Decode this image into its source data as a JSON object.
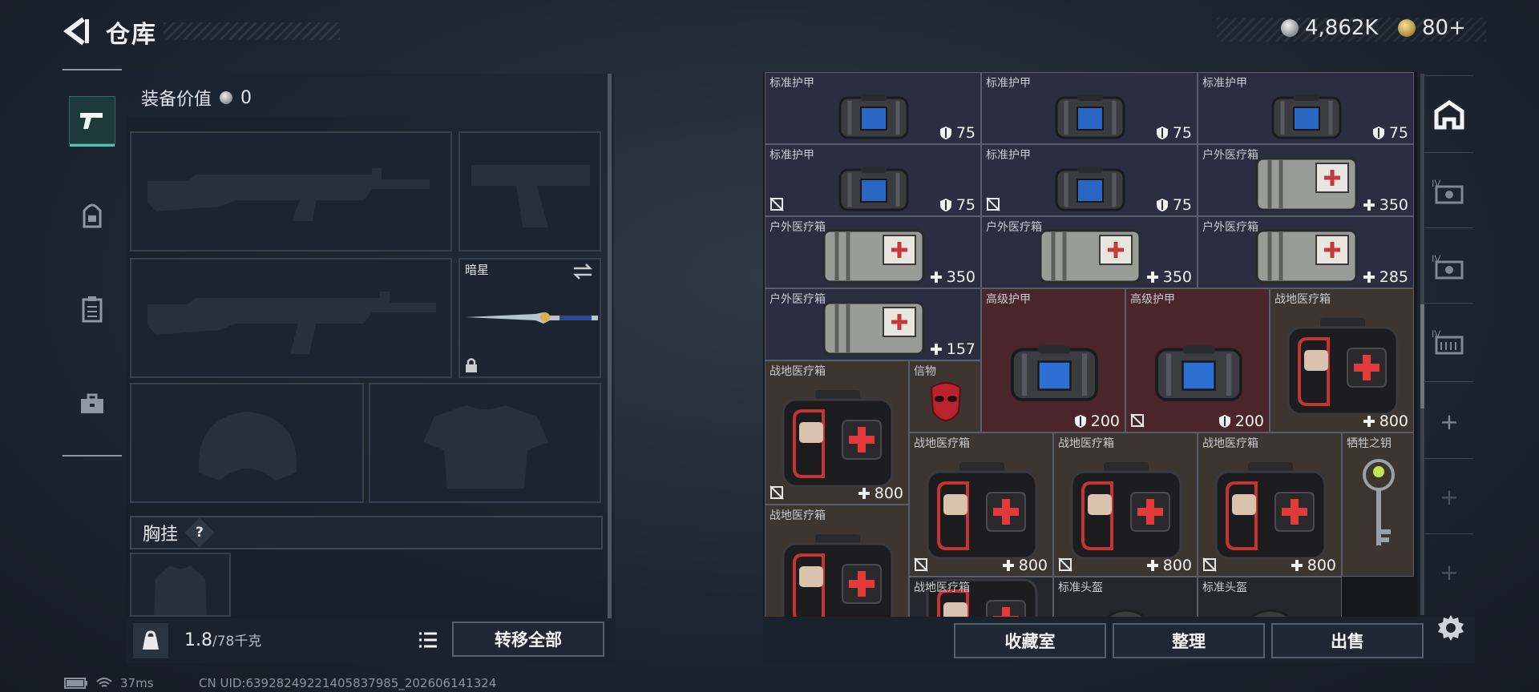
{
  "header": {
    "title": "仓库",
    "silver": "4,862K",
    "gold": "80+"
  },
  "loadout": {
    "value_label": "装备价值",
    "value": "0",
    "knife_name": "暗星",
    "chest_label": "胸挂",
    "help_glyph": "?",
    "weight_current": "1.8",
    "weight_max": "/78千克",
    "transfer_all": "转移全部"
  },
  "rail_tabs": [
    "gun-icon",
    "backpack-icon",
    "clipboard-icon",
    "toolbox-icon"
  ],
  "stash": {
    "items": [
      {
        "name": "标准护甲",
        "type": "armor",
        "value": "75",
        "val_icon": "shield"
      },
      {
        "name": "标准护甲",
        "type": "armor",
        "value": "75",
        "val_icon": "shield"
      },
      {
        "name": "标准护甲",
        "type": "armor",
        "value": "75",
        "val_icon": "shield"
      },
      {
        "name": "标准护甲",
        "type": "armor",
        "value": "75",
        "val_icon": "shield",
        "no_resell": true
      },
      {
        "name": "标准护甲",
        "type": "armor",
        "value": "75",
        "val_icon": "shield",
        "no_resell": true
      },
      {
        "name": "户外医疗箱",
        "type": "medkit",
        "value": "350",
        "val_icon": "plus"
      },
      {
        "name": "户外医疗箱",
        "type": "medkit",
        "value": "350",
        "val_icon": "plus"
      },
      {
        "name": "户外医疗箱",
        "type": "medkit",
        "value": "350",
        "val_icon": "plus"
      },
      {
        "name": "户外医疗箱",
        "type": "medkit",
        "value": "285",
        "val_icon": "plus"
      },
      {
        "name": "户外医疗箱",
        "type": "medkit",
        "value": "157",
        "val_icon": "plus"
      },
      {
        "name": "高级护甲",
        "type": "heavy-armor",
        "value": "200",
        "val_icon": "shield"
      },
      {
        "name": "高级护甲",
        "type": "heavy-armor",
        "value": "200",
        "val_icon": "shield",
        "no_resell": true
      },
      {
        "name": "战地医疗箱",
        "type": "firstaid",
        "value": "800",
        "val_icon": "plus"
      },
      {
        "name": "战地医疗箱",
        "type": "firstaid",
        "value": "800",
        "val_icon": "plus",
        "no_resell": true
      },
      {
        "name": "信物",
        "type": "mask",
        "value": "",
        "val_icon": ""
      },
      {
        "name": "战地医疗箱",
        "type": "firstaid",
        "value": "800",
        "val_icon": "plus",
        "no_resell": true
      },
      {
        "name": "战地医疗箱",
        "type": "firstaid",
        "value": "800",
        "val_icon": "plus",
        "no_resell": true
      },
      {
        "name": "战地医疗箱",
        "type": "firstaid",
        "value": "800",
        "val_icon": "plus",
        "no_resell": true
      },
      {
        "name": "牺牲之钥",
        "type": "key",
        "value": "",
        "val_icon": ""
      },
      {
        "name": "战地医疗箱",
        "type": "firstaid",
        "value": "",
        "val_icon": ""
      },
      {
        "name": "战地医疗箱",
        "type": "firstaid",
        "value": "",
        "val_icon": ""
      },
      {
        "name": "标准头盔",
        "type": "helmet",
        "value": "",
        "val_icon": ""
      },
      {
        "name": "标准头盔",
        "type": "helmet",
        "value": "",
        "val_icon": ""
      }
    ]
  },
  "right_rail": [
    "home-icon",
    "case-iv-icon",
    "case-iv-icon",
    "case-iv-icon",
    "+",
    "+",
    "+"
  ],
  "actions": {
    "collection": "收藏室",
    "organize": "整理",
    "sell": "出售"
  },
  "status": {
    "ping": "37ms",
    "uid": "CN UID:639282492214058379​85_202606141324"
  },
  "colors": {
    "accent": "#4ec2b0",
    "cell_navy": "#2b2e40",
    "cell_red": "#4a2529",
    "cell_brown": "#3d3530"
  }
}
